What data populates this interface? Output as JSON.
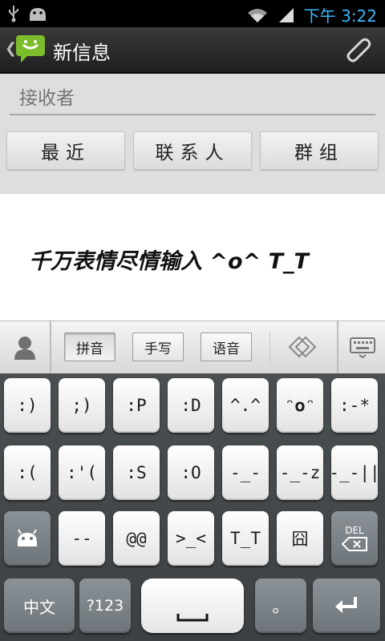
{
  "status_bar": {
    "time": "下午 3:22"
  },
  "app_bar": {
    "title": "新信息"
  },
  "recipient": {
    "placeholder": "接收者"
  },
  "recipient_buttons": {
    "recent": "最近",
    "contacts": "联系人",
    "group": "群组"
  },
  "message": {
    "text": "千万表情尽情输入 ^o^  T_T"
  },
  "ime_toolbar": {
    "pinyin": "拼音",
    "handwriting": "手写",
    "voice": "语音"
  },
  "keyboard": {
    "row1": [
      ":)",
      ";)",
      ":P",
      ":D",
      "^.^",
      "ᵔ𝐨ᵔ",
      ":-*"
    ],
    "row2": [
      ":(",
      ":'(",
      ":S",
      ":O",
      "-_-",
      "-_-z",
      "-_-||"
    ],
    "row3": [
      "--",
      "@@",
      ">_<",
      "T_T",
      "囧"
    ],
    "del_label": "DEL",
    "lang_label": "中文",
    "num_label": "?123",
    "period_label": "。"
  }
}
